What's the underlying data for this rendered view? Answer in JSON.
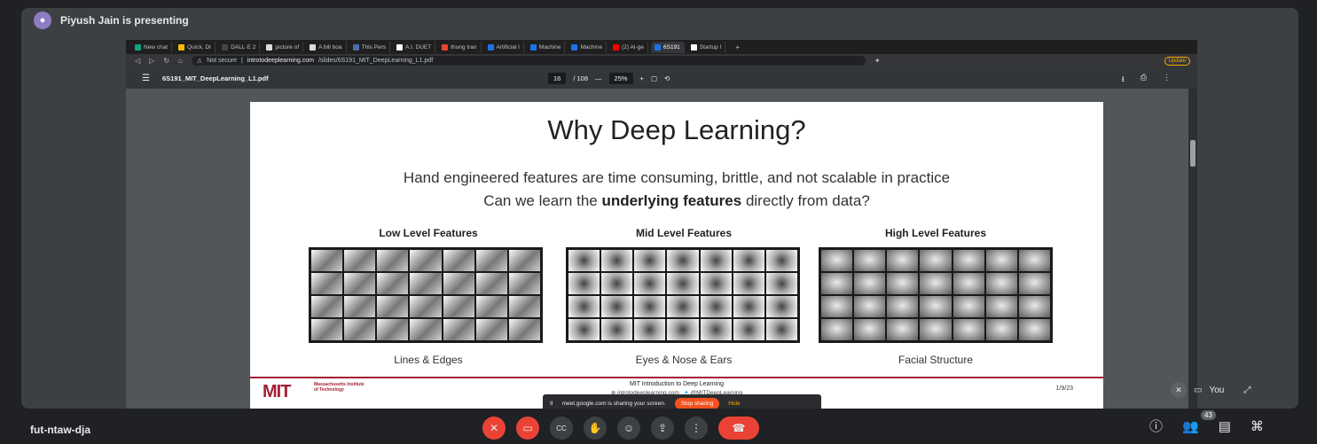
{
  "presenter": {
    "text": "Piyush Jain is presenting",
    "avatar_icon": "user-avatar-icon"
  },
  "browser": {
    "tabs": [
      {
        "label": "New chat",
        "color": "#10a37f"
      },
      {
        "label": "Quick, Dr",
        "color": "#fbbc04"
      },
      {
        "label": "DALL·E 2",
        "color": "#444444"
      },
      {
        "label": "picture of",
        "color": "#dddddd"
      },
      {
        "label": "A bill boa",
        "color": "#dddddd"
      },
      {
        "label": "This Pers",
        "color": "#4a6fa5"
      },
      {
        "label": "A.I. DUET",
        "color": "#ffffff"
      },
      {
        "label": "thung tran",
        "color": "#ea4335"
      },
      {
        "label": "Artificial I",
        "color": "#1a73e8"
      },
      {
        "label": "Machine",
        "color": "#1a73e8"
      },
      {
        "label": "Machine",
        "color": "#1a73e8"
      },
      {
        "label": "(2) AI-ge",
        "color": "#ff0000"
      },
      {
        "label": "6S191",
        "color": "#1a73e8",
        "active": true
      },
      {
        "label": "Startup I",
        "color": "#ffffff"
      }
    ],
    "address": {
      "warning": "Not secure",
      "host": "introtodeeplearning.com",
      "path": "/slides/6S191_MIT_DeepLearning_L1.pdf"
    },
    "update_label": "Update"
  },
  "pdf": {
    "filename": "6S191_MIT_DeepLearning_L1.pdf",
    "page": "16",
    "total": "/ 108",
    "zoom": "25%"
  },
  "slide": {
    "title": "Why Deep Learning?",
    "line1": "Hand engineered features are time consuming, brittle, and not scalable in practice",
    "line2_pre": "Can we learn the ",
    "line2_bold": "underlying features",
    "line2_post": " directly from data?",
    "features": [
      {
        "heading": "Low Level Features",
        "caption": "Lines & Edges"
      },
      {
        "heading": "Mid Level Features",
        "caption": "Eyes & Nose & Ears"
      },
      {
        "heading": "High Level Features",
        "caption": "Facial Structure"
      }
    ],
    "footer": {
      "logo": "MIT",
      "institute": "Massachusetts Institute of Technology",
      "course": "MIT Introduction to Deep Learning",
      "site": "introtodeeplearning.com",
      "twitter": "@MITDeepLearning",
      "date": "1/9/23"
    }
  },
  "sharing": {
    "text": "meet.google.com is sharing your screen.",
    "stop_label": "Stop sharing",
    "hide_label": "Hide"
  },
  "self_view": {
    "label": "You"
  },
  "meeting": {
    "code": "fut-ntaw-dja",
    "participants": "43"
  }
}
